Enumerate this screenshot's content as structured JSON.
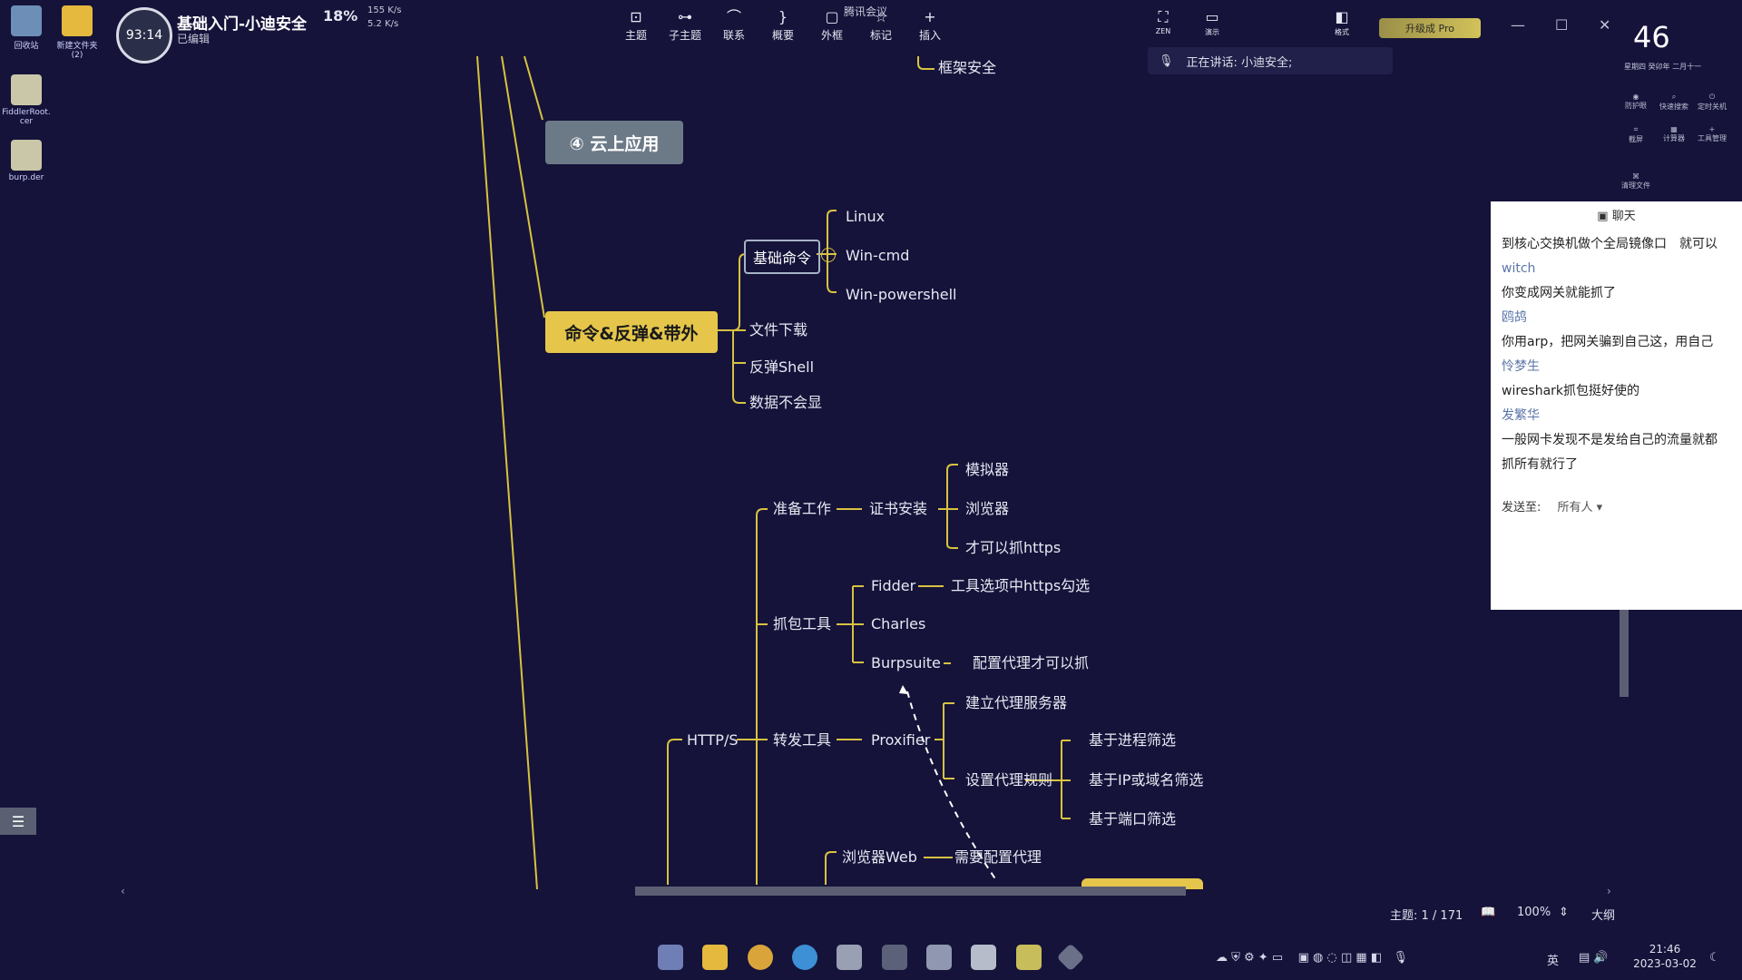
{
  "desktop": {
    "icons": [
      {
        "label": "回收站"
      },
      {
        "label": "新建文件夹\n(2)"
      },
      {
        "label": "FiddlerRoot.\ncer"
      },
      {
        "label": "burp.der"
      }
    ]
  },
  "topbar": {
    "timer": "93:14",
    "doc_title": "基础入门-小迪安全",
    "doc_status": "已编辑",
    "cpu": "18%",
    "net_up": "155 K/s",
    "net_down": "5.2 K/s",
    "meeting_label": "腾讯会议",
    "tools": [
      "主题",
      "子主题",
      "联系",
      "概要",
      "外框",
      "标记",
      "插入"
    ],
    "right_tools": [
      "ZEN",
      "演示",
      "格式"
    ],
    "upgrade": "升级成 Pro",
    "speaking": "正在讲话: 小迪安全;",
    "clock_big": "46",
    "clock_sub": "星期四 癸卯年 二月十一",
    "side_tools": [
      "防护眼",
      "快速搜索",
      "定时关机",
      "截屏",
      "计算器",
      "工具管理",
      "清理文件"
    ]
  },
  "mindmap": {
    "top_item": "框架安全",
    "cloud_app": "④ 云上应用",
    "cmd_root": "命令&反弹&带外",
    "basic_cmd": "基础命令",
    "linux": "Linux",
    "wincmd": "Win-cmd",
    "winps": "Win-powershell",
    "file_dl": "文件下载",
    "rev_shell": "反弹Shell",
    "no_echo": "数据不会显",
    "https_root": "HTTP/S",
    "prep": "准备工作",
    "cert_install": "证书安装",
    "emulator": "模拟器",
    "browser": "浏览器",
    "can_capture_https": "才可以抓https",
    "capture_tools": "抓包工具",
    "fiddler": "Fidder",
    "fiddler_note": "工具选项中https勾选",
    "charles": "Charles",
    "burpsuite": "Burpsuite",
    "burp_note": "配置代理才可以抓",
    "forward_tools": "转发工具",
    "proxifier": "Proxifier",
    "proxy_server": "建立代理服务器",
    "proxy_rules": "设置代理规则",
    "by_process": "基于进程筛选",
    "by_ip": "基于IP或域名筛选",
    "by_port": "基于端口筛选",
    "browser_web": "浏览器Web",
    "need_proxy": "需要配置代理"
  },
  "chat": {
    "title": "聊天",
    "messages": [
      {
        "type": "msg",
        "text": "到核心交换机做个全局镜像口　就可以"
      },
      {
        "type": "name",
        "text": "witch"
      },
      {
        "type": "msg",
        "text": "你变成网关就能抓了"
      },
      {
        "type": "name",
        "text": "鸥鸪"
      },
      {
        "type": "msg",
        "text": "你用arp，把网关骗到自己这，用自己"
      },
      {
        "type": "name",
        "text": "怜梦生"
      },
      {
        "type": "msg",
        "text": "wireshark抓包挺好使的"
      },
      {
        "type": "name",
        "text": "发繁华"
      },
      {
        "type": "msg",
        "text": "一般网卡发现不是发给自己的流量就都"
      },
      {
        "type": "msg",
        "text": "抓所有就行了"
      }
    ],
    "send_to_label": "发送至:",
    "send_to_value": "所有人"
  },
  "statusbar": {
    "topic_count": "主题: 1 / 171",
    "zoom": "100%",
    "outline": "大纲"
  },
  "taskbar": {
    "time": "21:46",
    "date": "2023-03-02",
    "ime": "英"
  },
  "colors": {
    "background": "#15133a",
    "accent_yellow": "#e5c64b",
    "node_gray": "#6c7a88",
    "line": "#d8c240"
  }
}
